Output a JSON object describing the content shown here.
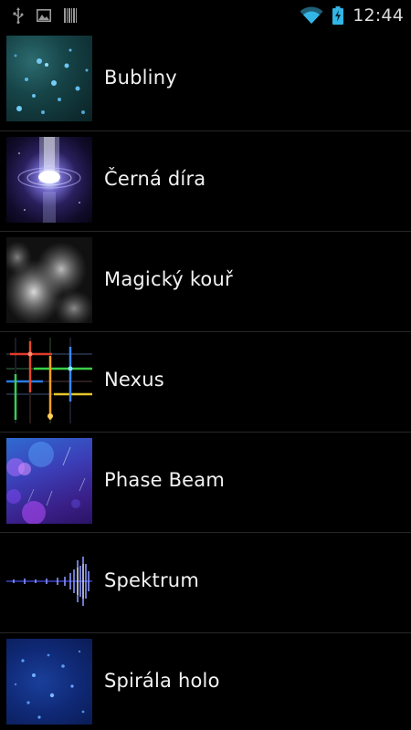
{
  "status_bar": {
    "time": "12:44",
    "left_icons": [
      "usb-icon",
      "gallery-notification-icon",
      "barcode-notification-icon"
    ],
    "right_icons": [
      "wifi-icon",
      "battery-charging-icon"
    ],
    "accent_color": "#33b5e5"
  },
  "list": {
    "items": [
      {
        "label": "Bubliny",
        "thumbnail": "bubbles-thumbnail"
      },
      {
        "label": "Černá díra",
        "thumbnail": "black-hole-thumbnail"
      },
      {
        "label": "Magický kouř",
        "thumbnail": "magic-smoke-thumbnail"
      },
      {
        "label": "Nexus",
        "thumbnail": "nexus-thumbnail"
      },
      {
        "label": "Phase Beam",
        "thumbnail": "phase-beam-thumbnail"
      },
      {
        "label": "Spektrum",
        "thumbnail": "spectrum-thumbnail"
      },
      {
        "label": "Spirála holo",
        "thumbnail": "holo-spiral-thumbnail"
      }
    ]
  }
}
